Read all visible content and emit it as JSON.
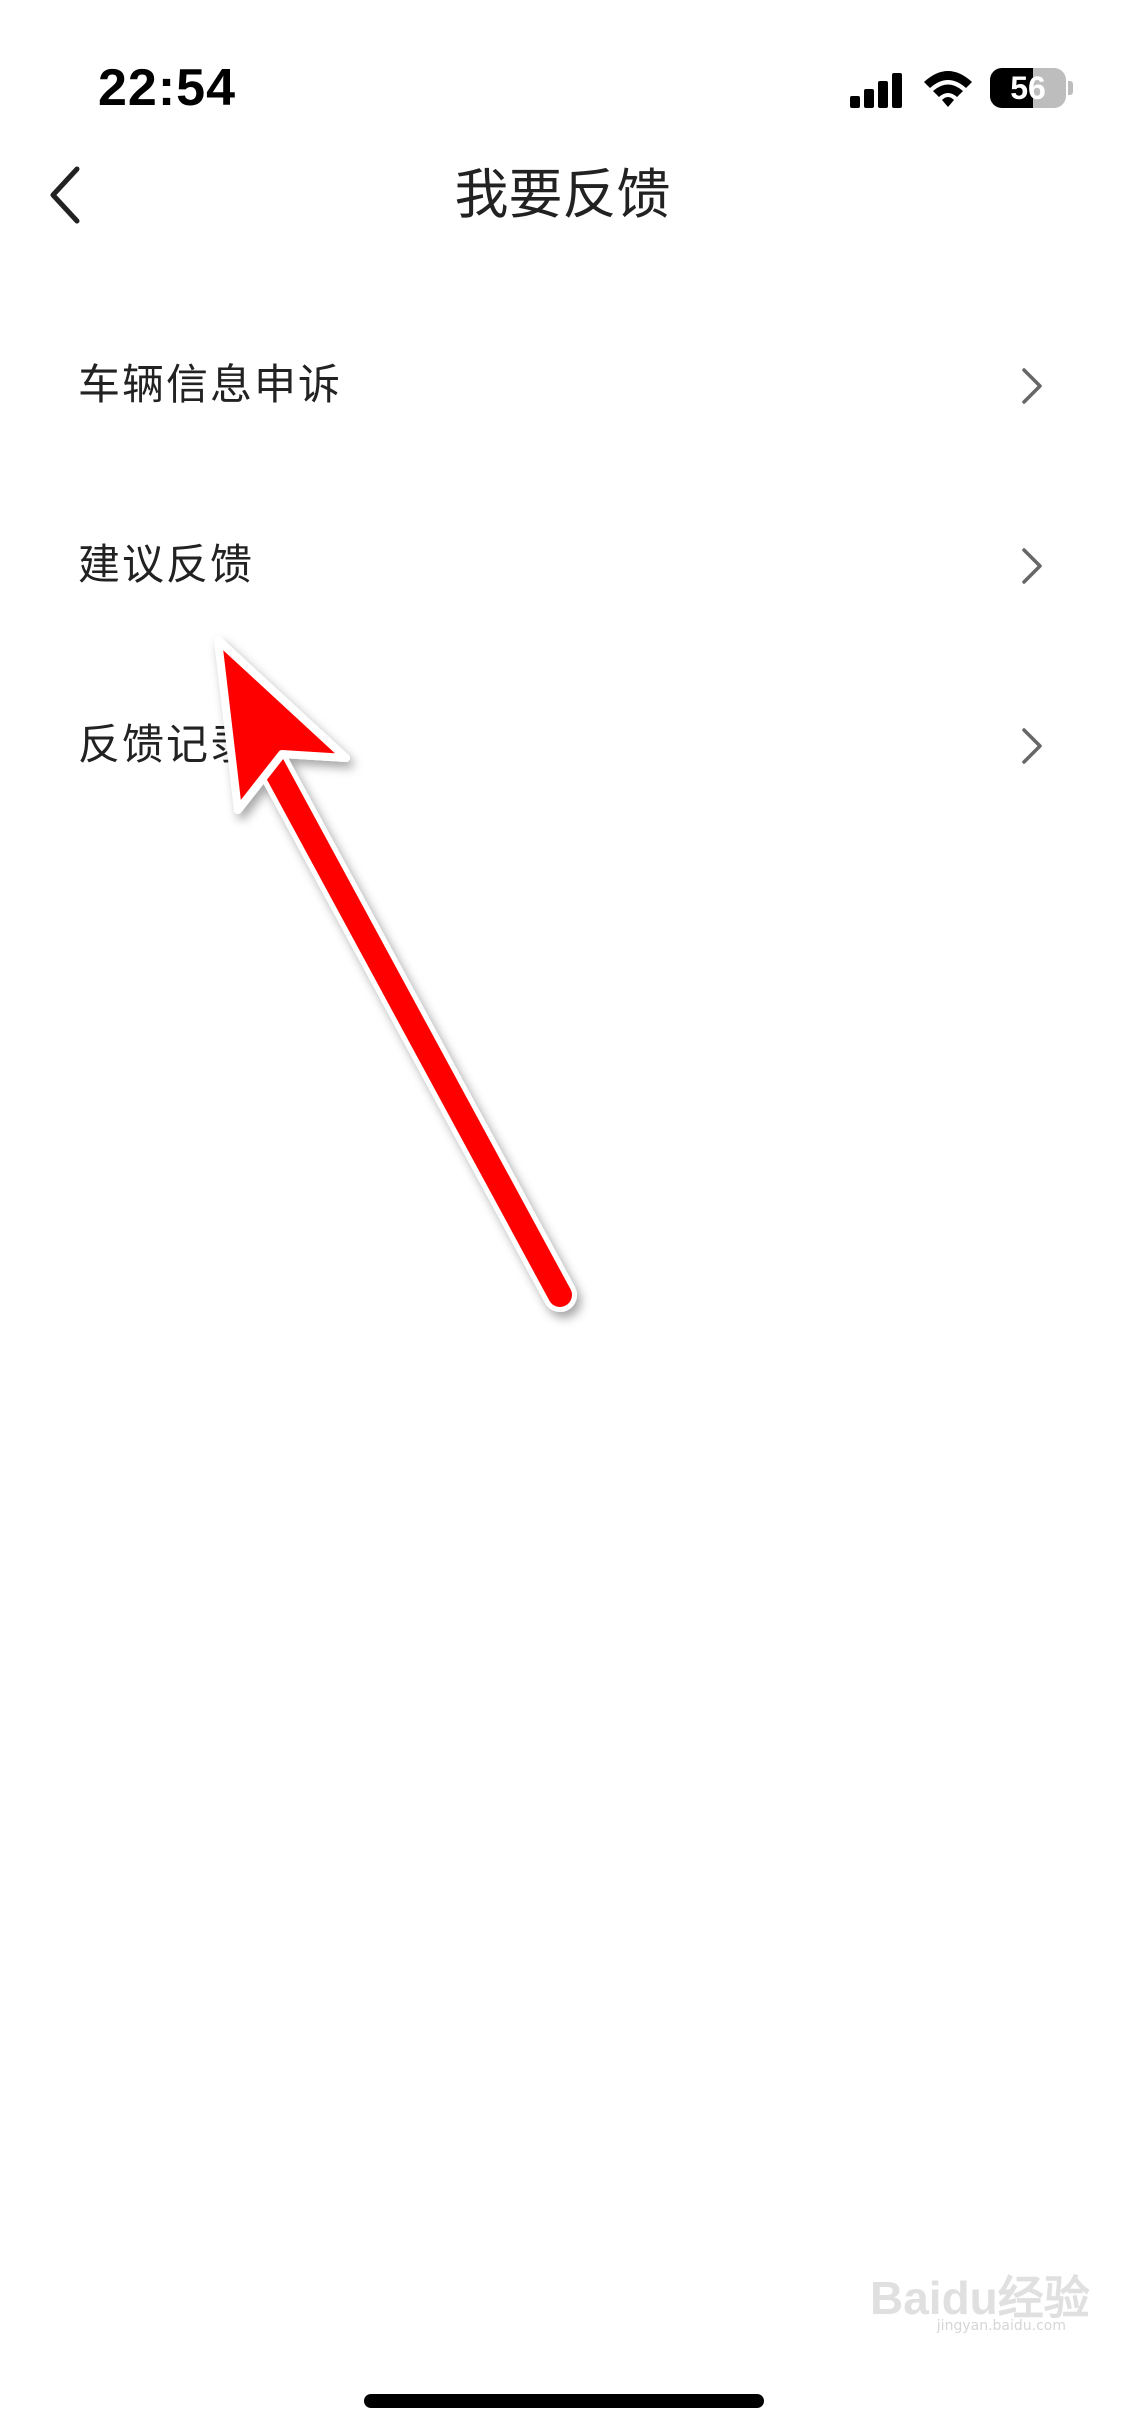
{
  "status_bar": {
    "time": "22:54",
    "battery_level": "56",
    "battery_fraction": 0.56,
    "signal_icon": "cellular-signal-icon",
    "wifi_icon": "wifi-icon"
  },
  "nav": {
    "back_icon": "chevron-left-icon",
    "title": "我要反馈"
  },
  "menu": {
    "items": [
      {
        "label": "车辆信息申诉",
        "icon": "chevron-right-icon"
      },
      {
        "label": "建议反馈",
        "icon": "chevron-right-icon"
      },
      {
        "label": "反馈记录",
        "icon": "chevron-right-icon"
      }
    ]
  },
  "annotation": {
    "type": "red-arrow",
    "points_to": "建议反馈",
    "color": "#ff0000"
  },
  "watermark": {
    "text": "Baidu经验",
    "subtext": "jingyan.baidu.com"
  },
  "colors": {
    "background": "#ffffff",
    "text_primary": "#222222",
    "chevron": "#666666",
    "arrow": "#ff0000"
  }
}
